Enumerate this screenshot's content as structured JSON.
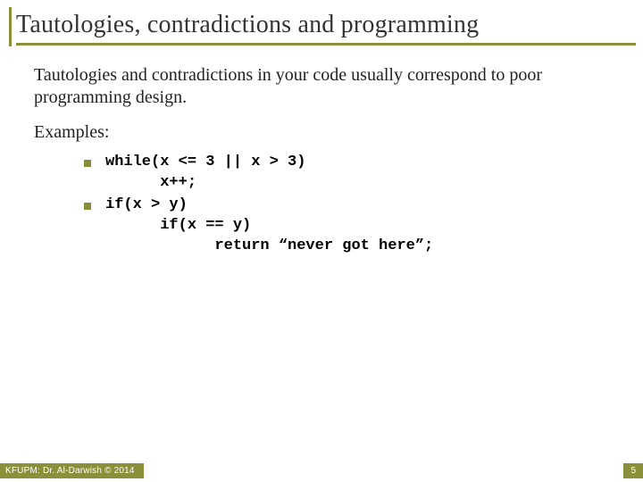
{
  "title": "Tautologies, contradictions and programming",
  "body": {
    "intro": "Tautologies and contradictions in your code usually correspond to poor programming design.",
    "examples_label": "Examples:",
    "bullets": [
      {
        "code": "while(x <= 3 || x > 3)\n      x++;"
      },
      {
        "code": "if(x > y)\n      if(x == y)\n            return “never got here”;"
      }
    ]
  },
  "footer": {
    "left": "KFUPM: Dr. Al-Darwish © 2014",
    "right": "5"
  }
}
